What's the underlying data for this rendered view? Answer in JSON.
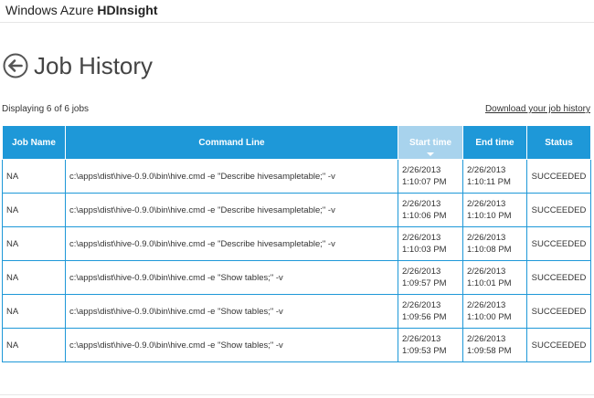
{
  "header": {
    "brand_prefix": "Windows Azure ",
    "brand_product": "HDInsight"
  },
  "page": {
    "title": "Job History",
    "back_icon": "circle-arrow-left-icon",
    "count_text": "Displaying 6 of 6 jobs",
    "download_link": "Download your job history"
  },
  "table": {
    "columns": [
      "Job Name",
      "Command Line",
      "Start time",
      "End time",
      "Status"
    ],
    "sorted_column": "Start time",
    "sort_direction": "descending",
    "rows": [
      {
        "job_name": "NA",
        "command": "c:\\apps\\dist\\hive-0.9.0\\bin\\hive.cmd -e \"Describe hivesampletable;\" -v",
        "start_date": "2/26/2013",
        "start_time": "1:10:07 PM",
        "end_date": "2/26/2013",
        "end_time": "1:10:11 PM",
        "status": "SUCCEEDED"
      },
      {
        "job_name": "NA",
        "command": "c:\\apps\\dist\\hive-0.9.0\\bin\\hive.cmd -e \"Describe hivesampletable;\" -v",
        "start_date": "2/26/2013",
        "start_time": "1:10:06 PM",
        "end_date": "2/26/2013",
        "end_time": "1:10:10 PM",
        "status": "SUCCEEDED"
      },
      {
        "job_name": "NA",
        "command": "c:\\apps\\dist\\hive-0.9.0\\bin\\hive.cmd -e \"Describe hivesampletable;\" -v",
        "start_date": "2/26/2013",
        "start_time": "1:10:03 PM",
        "end_date": "2/26/2013",
        "end_time": "1:10:08 PM",
        "status": "SUCCEEDED"
      },
      {
        "job_name": "NA",
        "command": "c:\\apps\\dist\\hive-0.9.0\\bin\\hive.cmd -e \"Show tables;\" -v",
        "start_date": "2/26/2013",
        "start_time": "1:09:57 PM",
        "end_date": "2/26/2013",
        "end_time": "1:10:01 PM",
        "status": "SUCCEEDED"
      },
      {
        "job_name": "NA",
        "command": "c:\\apps\\dist\\hive-0.9.0\\bin\\hive.cmd -e \"Show tables;\" -v",
        "start_date": "2/26/2013",
        "start_time": "1:09:56 PM",
        "end_date": "2/26/2013",
        "end_time": "1:10:00 PM",
        "status": "SUCCEEDED"
      },
      {
        "job_name": "NA",
        "command": "c:\\apps\\dist\\hive-0.9.0\\bin\\hive.cmd -e \"Show tables;\" -v",
        "start_date": "2/26/2013",
        "start_time": "1:09:53 PM",
        "end_date": "2/26/2013",
        "end_time": "1:09:58 PM",
        "status": "SUCCEEDED"
      }
    ]
  },
  "colors": {
    "header_blue": "#1e98d8",
    "sorted_header": "#a8d3ed",
    "text": "#333333"
  }
}
